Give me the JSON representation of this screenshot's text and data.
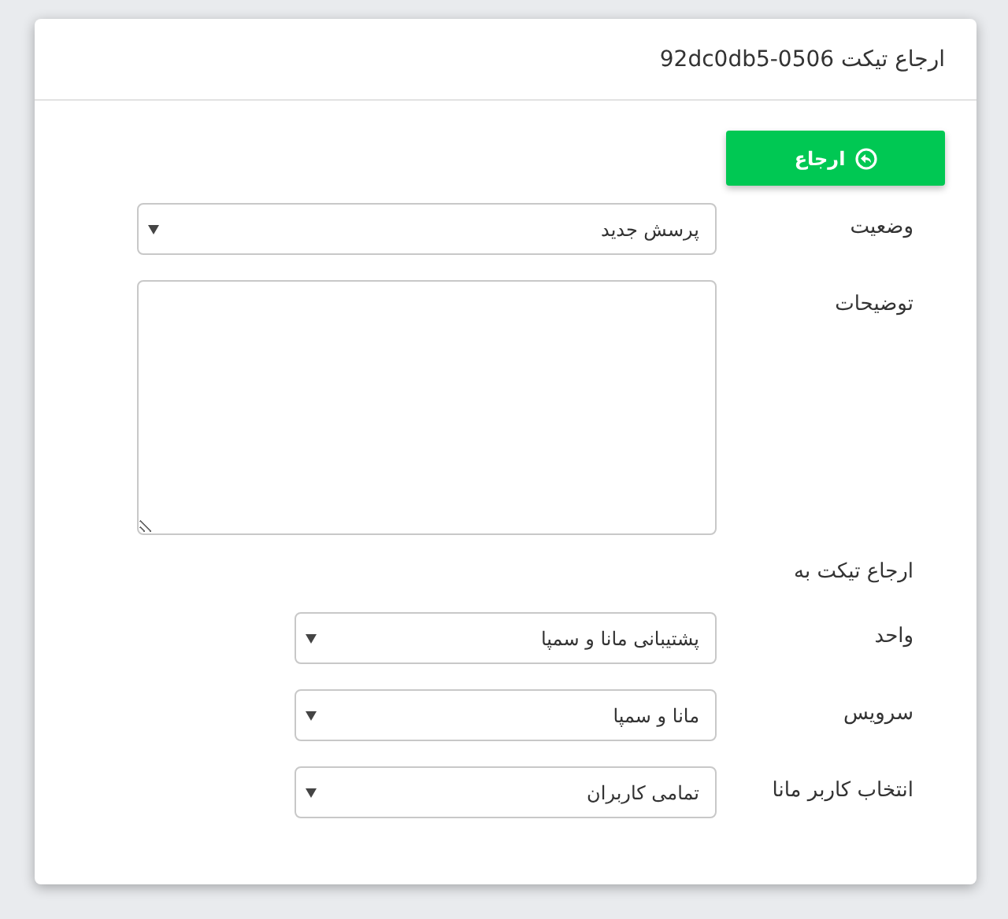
{
  "dialog": {
    "title": "ارجاع تیکت 92dc0db5-0506"
  },
  "submit_button": {
    "label": "ارجاع"
  },
  "fields": [
    {
      "kind": "select",
      "label": "وضعیت",
      "value": "پرسش جدید"
    },
    {
      "kind": "textarea",
      "label": "توضیحات"
    }
  ],
  "section_title": "ارجاع تیکت به",
  "assign_fields": [
    {
      "kind": "select",
      "label": "واحد",
      "value": "پشتیبانی مانا و سمپا"
    },
    {
      "kind": "select",
      "label": "سرویس",
      "value": "مانا و سمپا"
    },
    {
      "kind": "select",
      "label": "انتخاب کاربر مانا",
      "value": "تمامی کاربران"
    }
  ]
}
